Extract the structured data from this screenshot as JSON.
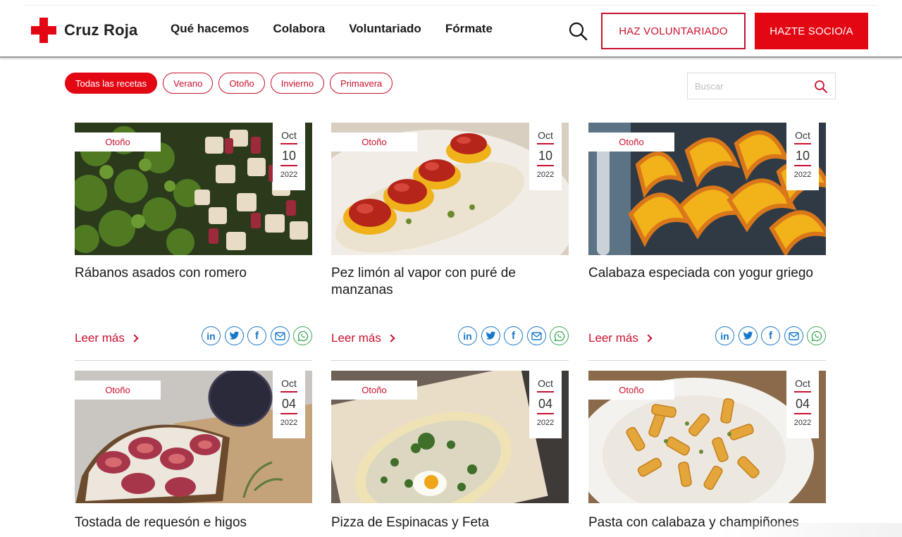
{
  "brand": {
    "name": "Cruz Roja",
    "color": "#e30613"
  },
  "nav": {
    "items": [
      "Qué hacemos",
      "Colabora",
      "Voluntariado",
      "Fórmate"
    ]
  },
  "header_buttons": {
    "volunteer": "HAZ VOLUNTARIADO",
    "member": "HAZTE SOCIO/A"
  },
  "filters": {
    "items": [
      "Todas las recetas",
      "Verano",
      "Otoño",
      "Invierno",
      "Primavera"
    ],
    "active": "Todas las recetas"
  },
  "search": {
    "placeholder": "Buscar"
  },
  "cards": [
    {
      "tag": "Otoño",
      "month": "Oct",
      "day": "10",
      "year": "2022",
      "title": "Rábanos asados con romero",
      "read_more": "Leer más"
    },
    {
      "tag": "Otoño",
      "month": "Oct",
      "day": "10",
      "year": "2022",
      "title": "Pez limón al vapor con puré de manzanas",
      "read_more": "Leer más"
    },
    {
      "tag": "Otoño",
      "month": "Oct",
      "day": "10",
      "year": "2022",
      "title": "Calabaza especiada con yogur griego",
      "read_more": "Leer más"
    },
    {
      "tag": "Otoño",
      "month": "Oct",
      "day": "04",
      "year": "2022",
      "title": "Tostada de requesón e higos"
    },
    {
      "tag": "Otoño",
      "month": "Oct",
      "day": "04",
      "year": "2022",
      "title": "Pizza de Espinacas y Feta"
    },
    {
      "tag": "Otoño",
      "month": "Oct",
      "day": "04",
      "year": "2022",
      "title": "Pasta con calabaza y champiñones"
    }
  ],
  "share_icons": [
    "linkedin-icon",
    "twitter-icon",
    "facebook-icon",
    "email-icon",
    "whatsapp-icon"
  ]
}
